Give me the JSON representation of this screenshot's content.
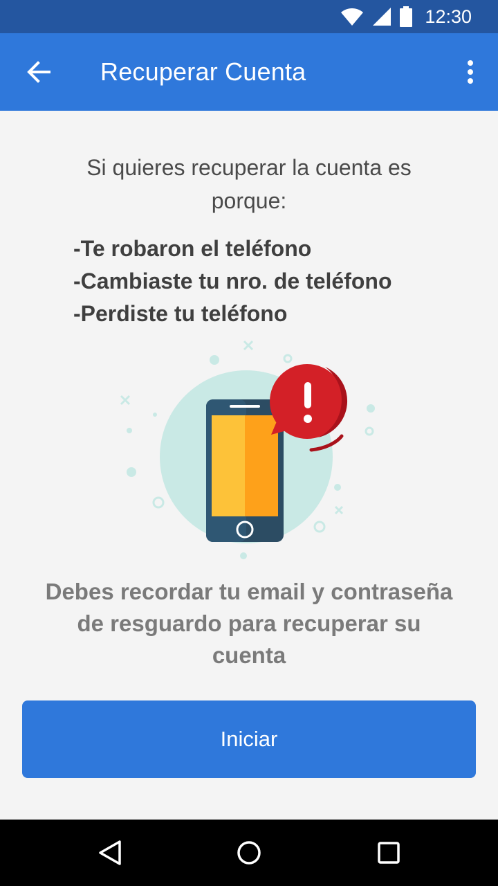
{
  "status_bar": {
    "time": "12:30",
    "icons": [
      "wifi-icon",
      "signal-icon",
      "battery-icon"
    ]
  },
  "app_bar": {
    "title": "Recuperar Cuenta",
    "back_icon": "arrow-left-icon",
    "menu_icon": "more-vert-icon"
  },
  "content": {
    "intro": "Si quieres recuperar la cuenta es porque:",
    "reasons": [
      "-Te robaron el teléfono",
      "-Cambiaste tu nro. de teléfono",
      "-Perdiste tu teléfono"
    ],
    "illustration_icon": "phone-alert-icon",
    "note": "Debes recordar tu email y contraseña de resguardo para recuperar su cuenta"
  },
  "actions": {
    "start_label": "Iniciar"
  },
  "nav_bar": {
    "icons": [
      "back-triangle-icon",
      "home-circle-icon",
      "recents-square-icon"
    ]
  },
  "colors": {
    "status_bar": "#2456a0",
    "app_bar": "#2f78db",
    "primary_button": "#2f78db",
    "alert_red": "#d32027",
    "background": "#f4f4f4"
  }
}
